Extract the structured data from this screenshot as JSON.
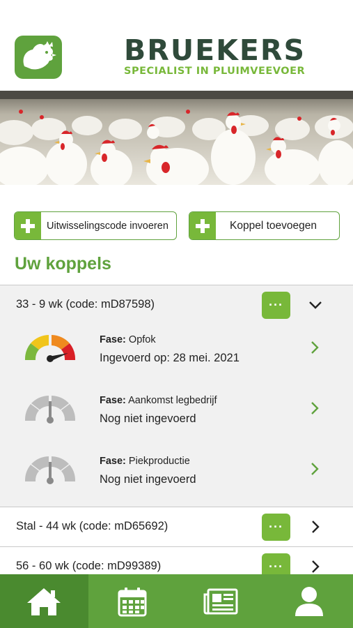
{
  "brand": {
    "name": "BRUEKERS",
    "tagline": "SPECIALIST IN PLUIMVEEVOER"
  },
  "actions": {
    "exchange_code_label": "Uitwisselingscode invoeren",
    "add_flock_label": "Koppel toevoegen"
  },
  "section_title": "Uw koppels",
  "more_label": "···",
  "flocks": [
    {
      "name": "33 - 9 wk (code: mD87598)",
      "expanded": true,
      "phases": [
        {
          "label": "Fase:",
          "name": "Opfok",
          "status": "Ingevoerd op: 28 mei. 2021",
          "active": true
        },
        {
          "label": "Fase:",
          "name": "Aankomst legbedrijf",
          "status": "Nog niet ingevoerd",
          "active": false
        },
        {
          "label": "Fase:",
          "name": "Piekproductie",
          "status": "Nog niet ingevoerd",
          "active": false
        }
      ]
    },
    {
      "name": "Stal - 44 wk (code: mD65692)",
      "expanded": false
    },
    {
      "name": "56 - 60 wk (code: mD99389)",
      "expanded": false
    }
  ],
  "colors": {
    "brand_green": "#5fa23d",
    "accent_green": "#78b83a",
    "brand_dark": "#2f4a3a"
  },
  "tabs": [
    {
      "icon": "home-icon",
      "active": true
    },
    {
      "icon": "calendar-icon",
      "active": false
    },
    {
      "icon": "newspaper-icon",
      "active": false
    },
    {
      "icon": "profile-icon",
      "active": false
    }
  ]
}
